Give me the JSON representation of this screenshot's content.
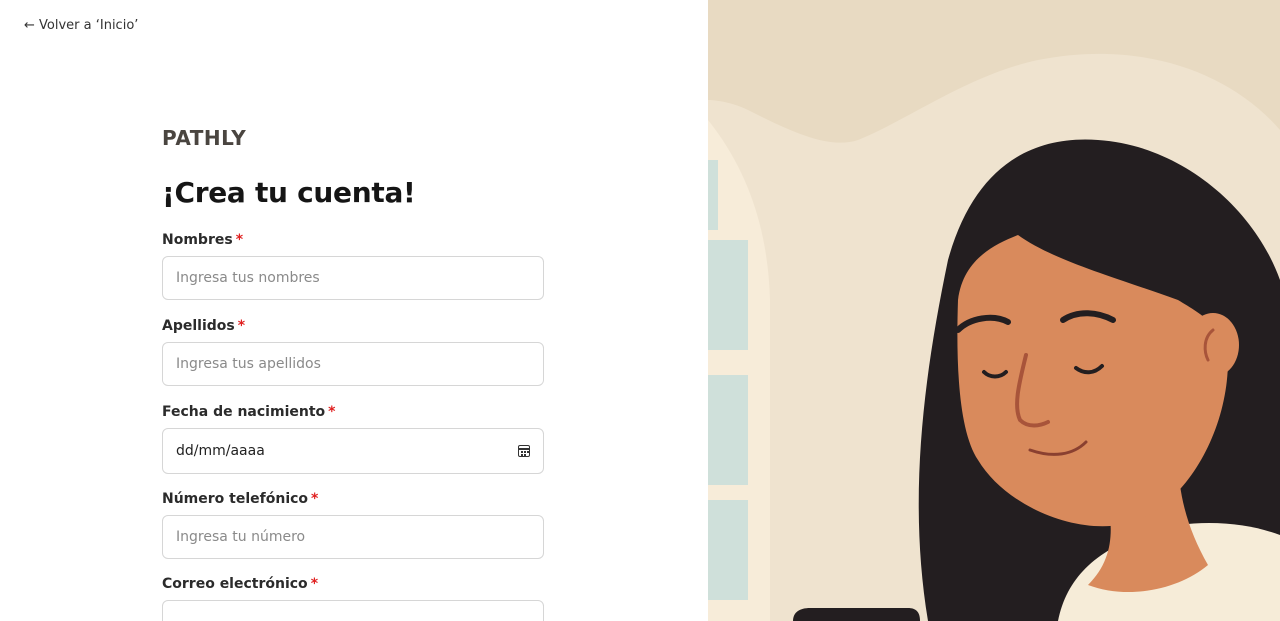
{
  "nav": {
    "back_label": "← Volver a ‘Inicio’"
  },
  "brand": {
    "name": "PATHLY"
  },
  "page": {
    "heading": "¡Crea tu cuenta!"
  },
  "form": {
    "required_mark": "*",
    "nombres": {
      "label": "Nombres",
      "placeholder": "Ingresa tus nombres"
    },
    "apellidos": {
      "label": "Apellidos",
      "placeholder": "Ingresa tus apellidos"
    },
    "fecha": {
      "label": "Fecha de nacimiento",
      "value": "dd/mm/aaaa",
      "icon": "calendar-icon"
    },
    "telefono": {
      "label": "Número telefónico",
      "placeholder": "Ingresa tu número"
    },
    "correo": {
      "label": "Correo electrónico",
      "placeholder": ""
    }
  },
  "illustration": {
    "subject": "woman-with-closed-eyes",
    "colors": {
      "background": "#efe3cf",
      "hair": "#231e20",
      "skin": "#d98a5c",
      "shirt": "#f6ecd8",
      "window": "#cfe0da"
    }
  }
}
